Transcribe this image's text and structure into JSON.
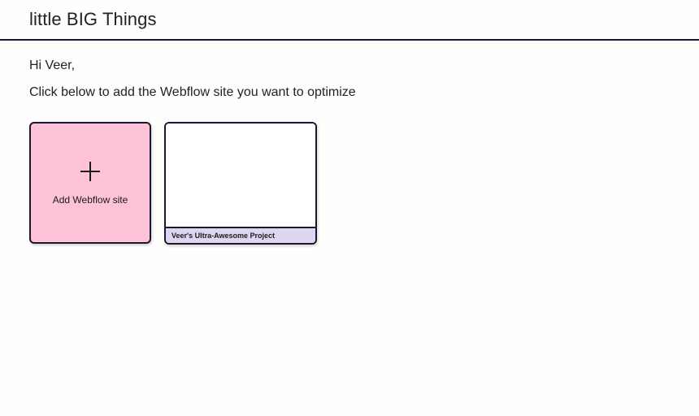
{
  "header": {
    "brand": "little BIG Things"
  },
  "main": {
    "greeting": "Hi Veer,",
    "instruction": "Click below to add the Webflow site you want to optimize"
  },
  "add_card": {
    "icon": "plus-icon",
    "label": "Add Webflow site",
    "background": "#fec3d6"
  },
  "sites": [
    {
      "name": "Veer's Ultra-Awesome Project",
      "footer_color": "#ded5ef"
    }
  ],
  "colors": {
    "border": "#1b1733",
    "background": "#fffefc"
  }
}
